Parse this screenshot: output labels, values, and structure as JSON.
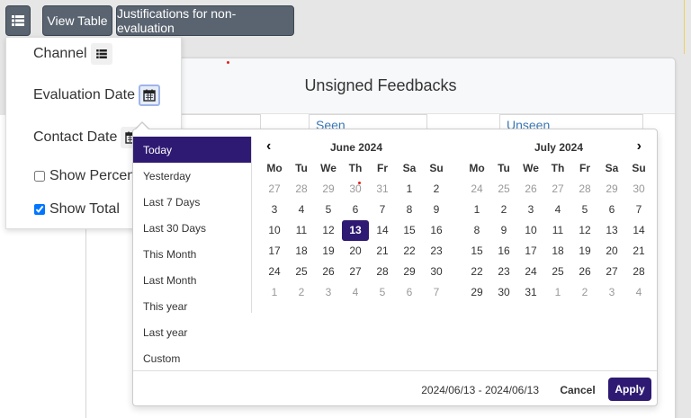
{
  "toolbar": {
    "menu_icon": "list-icon",
    "view_table_label": "View Table",
    "justifications_label": "Justifications for non-evaluation"
  },
  "card": {
    "title": "Unsigned Feedbacks",
    "tags": [
      "Seen",
      "Unseen"
    ]
  },
  "dropdown": {
    "channel": "Channel",
    "evaluation_date": "Evaluation Date",
    "contact_date": "Contact Date",
    "show_percent": {
      "label": "Show Percent",
      "checked": false
    },
    "show_total": {
      "label": "Show Total",
      "checked": true
    }
  },
  "picker": {
    "ranges": [
      "Today",
      "Yesterday",
      "Last 7 Days",
      "Last 30 Days",
      "This Month",
      "Last Month",
      "This year",
      "Last year",
      "Custom"
    ],
    "active_range": "Today",
    "weekdays": [
      "Mo",
      "Tu",
      "We",
      "Th",
      "Fr",
      "Sa",
      "Su"
    ],
    "left": {
      "title": "June 2024",
      "days": [
        [
          "27",
          "28",
          "29",
          "30",
          "31",
          "1",
          "2"
        ],
        [
          "3",
          "4",
          "5",
          "6",
          "7",
          "8",
          "9"
        ],
        [
          "10",
          "11",
          "12",
          "13",
          "14",
          "15",
          "16"
        ],
        [
          "17",
          "18",
          "19",
          "20",
          "21",
          "22",
          "23"
        ],
        [
          "24",
          "25",
          "26",
          "27",
          "28",
          "29",
          "30"
        ],
        [
          "1",
          "2",
          "3",
          "4",
          "5",
          "6",
          "7"
        ]
      ],
      "off": [
        [
          0,
          0
        ],
        [
          0,
          1
        ],
        [
          0,
          2
        ],
        [
          0,
          3
        ],
        [
          0,
          4
        ],
        [
          5,
          0
        ],
        [
          5,
          1
        ],
        [
          5,
          2
        ],
        [
          5,
          3
        ],
        [
          5,
          4
        ],
        [
          5,
          5
        ],
        [
          5,
          6
        ]
      ],
      "selected": [
        2,
        3
      ]
    },
    "right": {
      "title": "July 2024",
      "days": [
        [
          "24",
          "25",
          "26",
          "27",
          "28",
          "29",
          "30"
        ],
        [
          "1",
          "2",
          "3",
          "4",
          "5",
          "6",
          "7"
        ],
        [
          "8",
          "9",
          "10",
          "11",
          "12",
          "13",
          "14"
        ],
        [
          "15",
          "16",
          "17",
          "18",
          "19",
          "20",
          "21"
        ],
        [
          "22",
          "23",
          "24",
          "25",
          "26",
          "27",
          "28"
        ],
        [
          "29",
          "30",
          "31",
          "1",
          "2",
          "3",
          "4"
        ]
      ],
      "off": [
        [
          0,
          0
        ],
        [
          0,
          1
        ],
        [
          0,
          2
        ],
        [
          0,
          3
        ],
        [
          0,
          4
        ],
        [
          0,
          5
        ],
        [
          0,
          6
        ],
        [
          5,
          3
        ],
        [
          5,
          4
        ],
        [
          5,
          5
        ],
        [
          5,
          6
        ]
      ]
    },
    "selected_range_text": "2024/06/13 - 2024/06/13",
    "cancel_label": "Cancel",
    "apply_label": "Apply",
    "accent_color": "#2e1a72"
  }
}
